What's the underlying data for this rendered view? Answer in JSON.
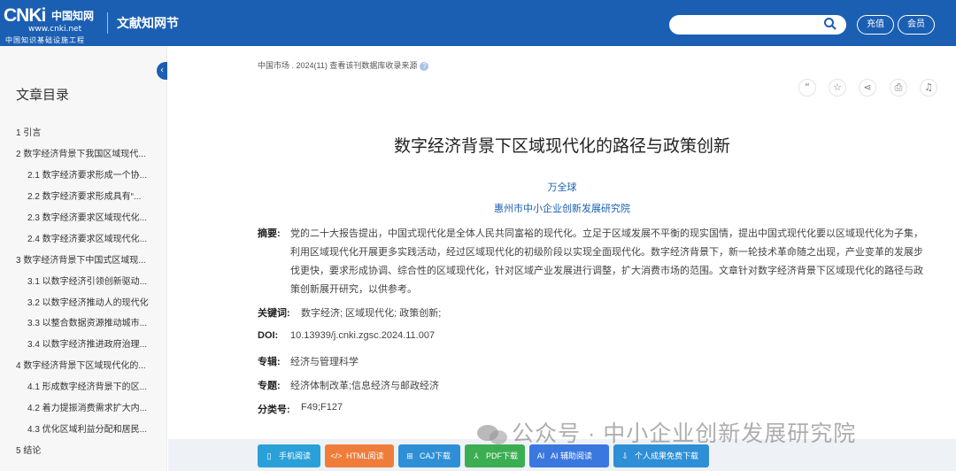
{
  "header": {
    "logo_big": "CNKi",
    "logo_cn": "中国知网",
    "logo_url": "www.cnki.net",
    "logo_sub": "中国知识基础设施工程",
    "product_name": "文献知网节",
    "search_placeholder": "",
    "recharge_label": "充值",
    "member_label": "会员",
    "bg_color": "#1b5fb3"
  },
  "sidebar": {
    "title": "文章目录",
    "items": [
      {
        "label": "1 引言",
        "level": 1
      },
      {
        "label": "2 数字经济背景下我国区域现代...",
        "level": 1
      },
      {
        "label": "2.1 数字经济要求形成一个协...",
        "level": 2
      },
      {
        "label": "2.2 数字经济要求形成具有“...",
        "level": 2
      },
      {
        "label": "2.3 数字经济要求区域现代化...",
        "level": 2
      },
      {
        "label": "2.4 数字经济要求区域现代化...",
        "level": 2
      },
      {
        "label": "3 数字经济背景下中国式区域现...",
        "level": 1
      },
      {
        "label": "3.1 以数字经济引领创新驱动...",
        "level": 2
      },
      {
        "label": "3.2 以数字经济推动人的现代化",
        "level": 2
      },
      {
        "label": "3.3 以整合数据资源推动城市...",
        "level": 2
      },
      {
        "label": "3.4 以数字经济推进政府治理...",
        "level": 2
      },
      {
        "label": "4 数字经济背景下区域现代化的...",
        "level": 1
      },
      {
        "label": "4.1 形成数字经济背景下的区...",
        "level": 2
      },
      {
        "label": "4.2 着力提振消费需求扩大内...",
        "level": 2
      },
      {
        "label": "4.3 优化区域利益分配和居民...",
        "level": 2
      },
      {
        "label": "5 结论",
        "level": 1
      }
    ]
  },
  "article": {
    "breadcrumb": "中国市场 . 2024(11)   查看该刊数据库收录来源",
    "title": "数字经济背景下区域现代化的路径与政策创新",
    "author": "万全球",
    "affiliation": "惠州市中小企业创新发展研究院",
    "abstract_label": "摘要:",
    "abstract_lines": [
      "党的二十大报告提出，中国式现代化是全体人民共同富裕的现代化。立足于区域发展不平衡的现实国情，提出中国式现代化要以区域现代化为子集，",
      "利用区域现代化开展更多实践活动，经过区域现代化的初级阶段以实现全面现代化。数字经济背景下，新一轮技术革命随之出现，产业变革的发展步",
      "伐更快，要求形成协调、综合性的区域现代化，针对区域产业发展进行调整，扩大消费市场的范围。文章针对数字经济背景下区域现代化的路径与政",
      "策创新展开研究，以供参考。"
    ],
    "keywords_label": "关键词:",
    "keywords": "数字经济;  区域现代化;  政策创新;",
    "doi_label": "DOI:",
    "doi": "10.13939/j.cnki.zgsc.2024.11.007",
    "series_label": "专辑:",
    "series": "经济与管理科学",
    "topic_label": "专题:",
    "topic": "经济体制改革;信息经济与邮政经济",
    "class_label": "分类号:",
    "class_no": "F49;F127"
  },
  "actions": [
    "quote-icon",
    "star-icon",
    "share-icon",
    "print-icon",
    "bell-icon"
  ],
  "watermark": "公众号 · 中小企业创新发展研究院",
  "downloads": [
    {
      "label": "手机阅读",
      "color": "#2aa0d8",
      "icon": "▯"
    },
    {
      "label": "HTML阅读",
      "color": "#f07c3a",
      "icon": "</>"
    },
    {
      "label": "CAJ下载",
      "color": "#2e8fd6",
      "icon": "⊞"
    },
    {
      "label": "PDF下载",
      "color": "#3cae52",
      "icon": "⅄"
    },
    {
      "label": "AI 辅助阅读",
      "color": "#3a78e0",
      "icon": "AI"
    },
    {
      "label": "个人成果免费下载",
      "color": "#2e8fd6",
      "icon": "⇩"
    }
  ]
}
